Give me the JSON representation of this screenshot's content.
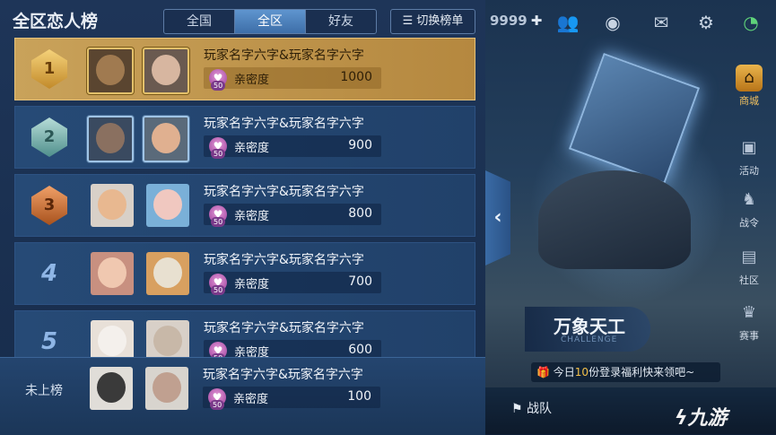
{
  "panel": {
    "title": "全区恋人榜",
    "tabs": [
      "全国",
      "全区",
      "好友"
    ],
    "active_tab": "全区",
    "switch_label": "切换榜单"
  },
  "rows": [
    {
      "rank": "1",
      "name": "玩家名字六字&玩家名字六字",
      "level": "50",
      "intimacy_label": "亲密度",
      "intimacy": "1000"
    },
    {
      "rank": "2",
      "name": "玩家名字六字&玩家名字六字",
      "level": "50",
      "intimacy_label": "亲密度",
      "intimacy": "900"
    },
    {
      "rank": "3",
      "name": "玩家名字六字&玩家名字六字",
      "level": "50",
      "intimacy_label": "亲密度",
      "intimacy": "800"
    },
    {
      "rank": "4",
      "name": "玩家名字六字&玩家名字六字",
      "level": "50",
      "intimacy_label": "亲密度",
      "intimacy": "700"
    },
    {
      "rank": "5",
      "name": "玩家名字六字&玩家名字六字",
      "level": "50",
      "intimacy_label": "亲密度",
      "intimacy": "600"
    }
  ],
  "mine": {
    "status": "未上榜",
    "name": "玩家名字六字&玩家名字六字",
    "level": "50",
    "intimacy_label": "亲密度",
    "intimacy": "100"
  },
  "background": {
    "coins": "9999",
    "side_menu": [
      "商城",
      "活动",
      "战令",
      "社区",
      "赛事"
    ],
    "challenge_title": "万象天工",
    "challenge_sub": "CHALLENGE",
    "promo_prefix": "今日",
    "promo_highlight": "10",
    "promo_suffix": "份登录福利快来领吧~",
    "bottom_team": "战队",
    "watermark": "九游"
  },
  "colors": {
    "accent_gold": "#c9a25a",
    "tab_active": "#3d6ea8",
    "panel_bg": "#1e3558"
  }
}
